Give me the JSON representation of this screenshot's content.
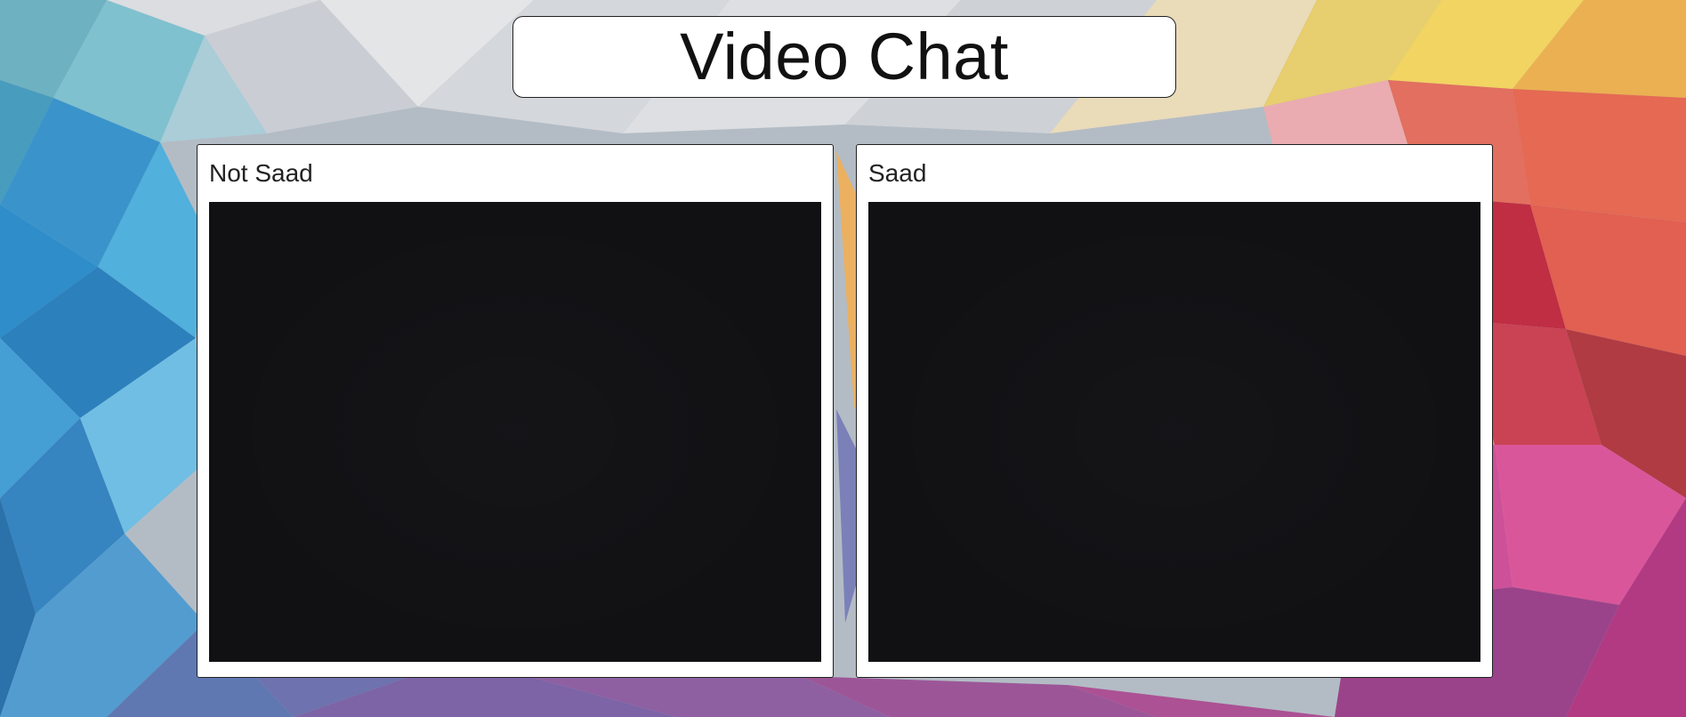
{
  "page": {
    "title": "Video Chat"
  },
  "participants": [
    {
      "name": "Not Saad"
    },
    {
      "name": "Saad"
    }
  ],
  "colors": {
    "panel_background": "#ffffff",
    "video_background": "#111114",
    "title_text": "#111111"
  }
}
